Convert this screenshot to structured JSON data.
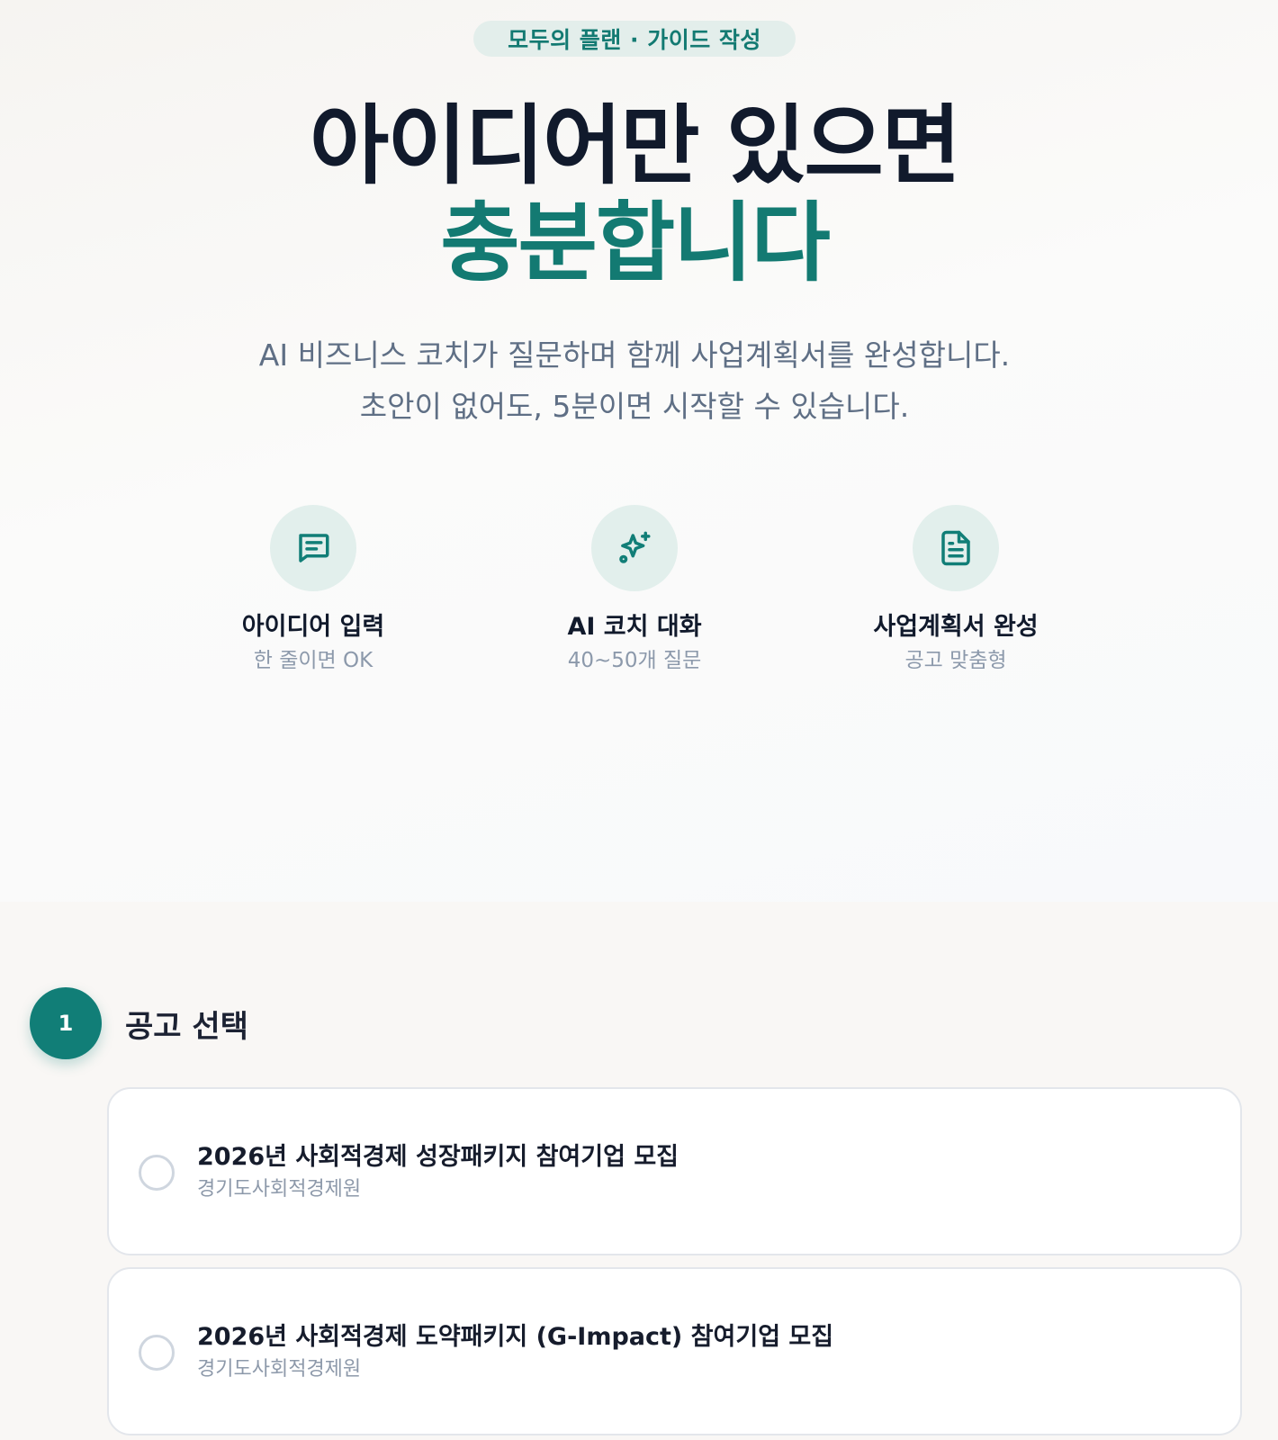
{
  "hero": {
    "badge": "모두의 플랜 · 가이드 작성",
    "headline_line1": "아이디어만 있으면",
    "headline_line2": "충분합니다",
    "subtitle_line1": "AI 비즈니스 코치가 질문하며 함께 사업계획서를 완성합니다.",
    "subtitle_line2": "초안이 없어도, 5분이면 시작할 수 있습니다.",
    "accent_color": "#137a72",
    "features": [
      {
        "icon": "message-square-text-icon",
        "title": "아이디어 입력",
        "desc": "한 줄이면 OK"
      },
      {
        "icon": "sparkles-icon",
        "title": "AI 코치 대화",
        "desc": "40~50개 질문"
      },
      {
        "icon": "document-text-icon",
        "title": "사업계획서 완성",
        "desc": "공고 맞춤형"
      }
    ]
  },
  "step1": {
    "number": "1",
    "label": "공고 선택",
    "announcements": [
      {
        "title": "2026년 사회적경제 성장패키지 참여기업 모집",
        "org": "경기도사회적경제원",
        "selected": false
      },
      {
        "title": "2026년 사회적경제 도약패키지 (G-Impact) 참여기업 모집",
        "org": "경기도사회적경제원",
        "selected": false
      }
    ]
  }
}
